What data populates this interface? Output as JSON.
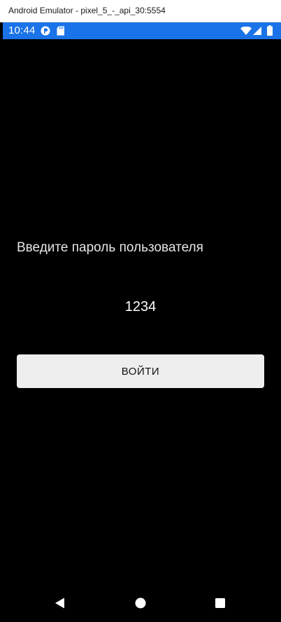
{
  "window": {
    "title": "Android Emulator - pixel_5_-_api_30:5554"
  },
  "statusbar": {
    "time": "10:44",
    "icons": [
      "app-notification-icon",
      "sd-card-icon",
      "wifi-icon",
      "signal-icon",
      "battery-icon"
    ],
    "color": "#1a73e8"
  },
  "main": {
    "prompt": "Введите пароль пользователя",
    "password_value": "1234",
    "login_label": "ВОЙТИ"
  },
  "navbar": {
    "icons": [
      "back-icon",
      "home-icon",
      "recents-icon"
    ]
  }
}
